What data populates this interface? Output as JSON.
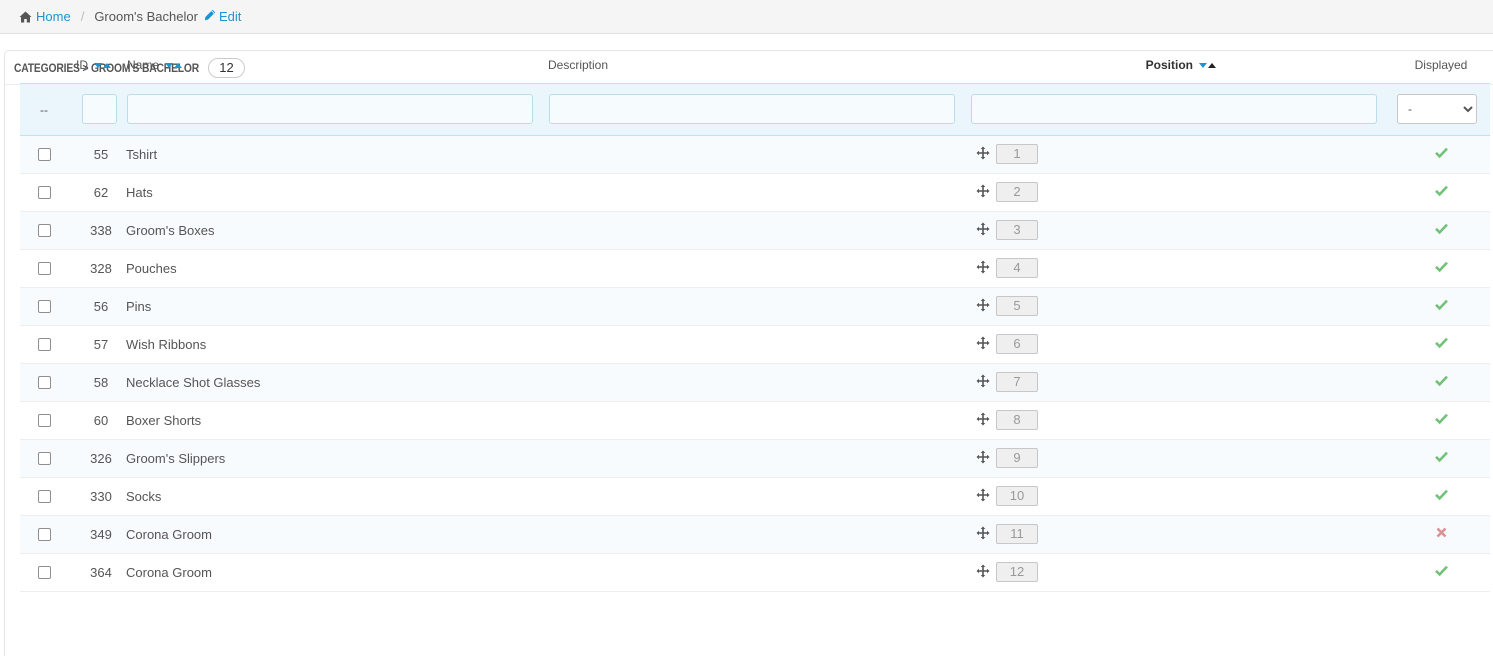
{
  "breadcrumb": {
    "home": "Home",
    "separator": "/",
    "current": "Groom's Bachelor",
    "edit": "Edit"
  },
  "panel": {
    "title": "Categories > Groom's Bachelor",
    "count": "12"
  },
  "columns": {
    "id": "ID",
    "name": "Name",
    "description": "Description",
    "position": "Position",
    "displayed": "Displayed"
  },
  "filters": {
    "bulk": "--",
    "displayed_selected": "-"
  },
  "colors": {
    "accent": "#1e94cf",
    "success": "#72c279",
    "danger": "#e08f95"
  },
  "icons": {
    "home": "home-icon",
    "edit": "pencil-icon",
    "drag": "move-icon",
    "enabled": "check-icon",
    "disabled": "cross-icon"
  },
  "rows": [
    {
      "id": "55",
      "name": "Tshirt",
      "description": "",
      "position": "1",
      "displayed": true
    },
    {
      "id": "62",
      "name": "Hats",
      "description": "",
      "position": "2",
      "displayed": true
    },
    {
      "id": "338",
      "name": "Groom's Boxes",
      "description": "",
      "position": "3",
      "displayed": true
    },
    {
      "id": "328",
      "name": "Pouches",
      "description": "",
      "position": "4",
      "displayed": true
    },
    {
      "id": "56",
      "name": "Pins",
      "description": "",
      "position": "5",
      "displayed": true
    },
    {
      "id": "57",
      "name": "Wish Ribbons",
      "description": "",
      "position": "6",
      "displayed": true
    },
    {
      "id": "58",
      "name": "Necklace Shot Glasses",
      "description": "",
      "position": "7",
      "displayed": true
    },
    {
      "id": "60",
      "name": "Boxer Shorts",
      "description": "",
      "position": "8",
      "displayed": true
    },
    {
      "id": "326",
      "name": "Groom's Slippers",
      "description": "",
      "position": "9",
      "displayed": true
    },
    {
      "id": "330",
      "name": "Socks",
      "description": "",
      "position": "10",
      "displayed": true
    },
    {
      "id": "349",
      "name": "Corona Groom",
      "description": "",
      "position": "11",
      "displayed": false
    },
    {
      "id": "364",
      "name": "Corona Groom",
      "description": "",
      "position": "12",
      "displayed": true
    }
  ]
}
